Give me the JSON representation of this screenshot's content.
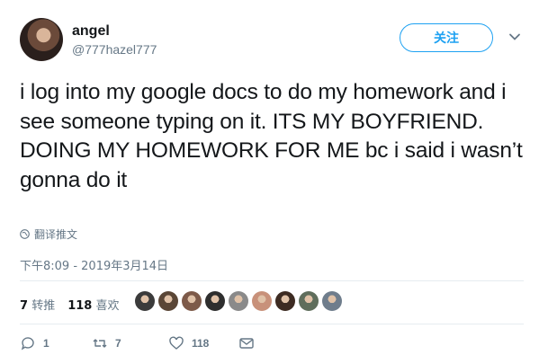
{
  "user": {
    "name": "angel",
    "handle": "@777hazel777"
  },
  "follow_label": "关注",
  "tweet_text": "i log into my google docs to do my homework and i see someone typing on it. ITS MY BOYFRIEND. DOING MY HOMEWORK FOR ME bc i said i wasn’t gonna do it",
  "translate_label": "翻译推文",
  "timestamp": "下午8:09 - 2019年3月14日",
  "stats": {
    "retweets_count": "7",
    "retweets_label": "转推",
    "likes_count": "118",
    "likes_label": "喜欢"
  },
  "liker_avatars": [
    "#3b3b3b",
    "#5a4636",
    "#7d5a49",
    "#2e2e2e",
    "#8a8a8a",
    "#c8917a",
    "#3d2b22",
    "#5f6e5c",
    "#6f7d8c"
  ],
  "actions": {
    "replies": "1",
    "retweets": "7",
    "likes": "118"
  },
  "colors": {
    "accent": "#1da1f2",
    "secondary_text": "#657786",
    "divider": "#e6ecf0"
  }
}
